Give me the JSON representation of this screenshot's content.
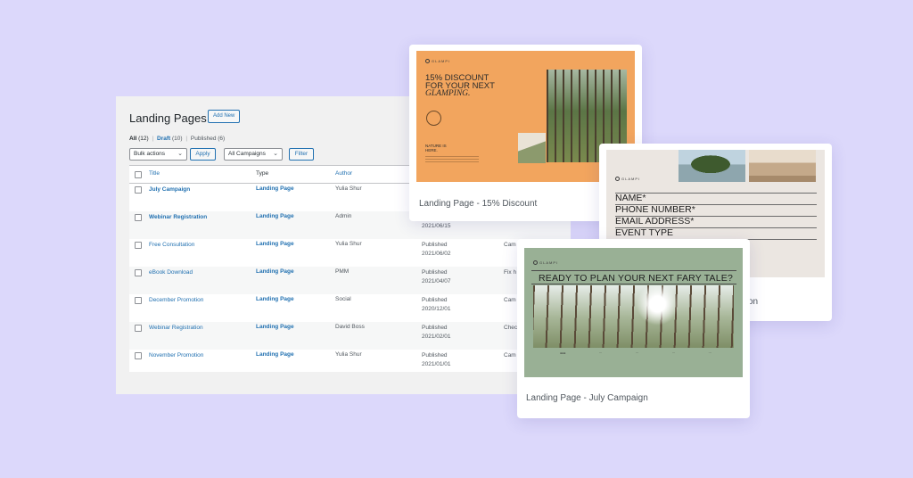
{
  "admin": {
    "page_title": "Landing Pages",
    "add_new_label": "Add New",
    "filters": {
      "all_label": "All",
      "all_count": "(12)",
      "separator": "|",
      "draft_label": "Draft",
      "draft_count": "(10)",
      "published_label": "Published",
      "published_count": "(6)"
    },
    "bulk_actions": "Bulk actions",
    "apply_label": "Apply",
    "campaigns_select": "All Campaigns",
    "filter_label": "Filter",
    "columns": {
      "title": "Title",
      "type": "Type",
      "author": "Author"
    },
    "rows": [
      {
        "title": "July Campaign",
        "type": "Landing Page",
        "author": "Yulia Shur",
        "status": "",
        "date": "",
        "campaign": "",
        "bold": true
      },
      {
        "title": "Webinar Registration",
        "type": "Landing Page",
        "author": "Admin",
        "status": "",
        "date": "2021/06/15",
        "campaign": "",
        "bold": true
      },
      {
        "title": "Free Consultation",
        "type": "Landing Page",
        "author": "Yulia Shur",
        "status": "Published",
        "date": "2021/06/02",
        "campaign": "Cam",
        "bold": false
      },
      {
        "title": "eBook Download",
        "type": "Landing Page",
        "author": "PMM",
        "status": "Published",
        "date": "2021/04/07",
        "campaign": "Fix h",
        "bold": false
      },
      {
        "title": "December Promotion",
        "type": "Landing Page",
        "author": "Social",
        "status": "Published",
        "date": "2020/12/01",
        "campaign": "Cam",
        "bold": false
      },
      {
        "title": "Webinar Registration",
        "type": "Landing Page",
        "author": "David Boss",
        "status": "Published",
        "date": "2021/02/01",
        "campaign": "Chec",
        "bold": false
      },
      {
        "title": "November Promotion",
        "type": "Landing Page",
        "author": "Yulia Shur",
        "status": "Published",
        "date": "2021/01/01",
        "campaign": "Cam",
        "bold": false
      }
    ]
  },
  "cards": {
    "discount": {
      "label": "Landing Page - 15% Discount",
      "brand": "GLAMPI",
      "headline_1": "15% DISCOUNT",
      "headline_2": "FOR YOUR NEXT",
      "headline_3": "GLAMPING.",
      "nature_1": "NATURE IS",
      "nature_2": "HERE."
    },
    "form": {
      "label_tail": "on",
      "brand": "GLAMPI",
      "fields": [
        "NAME*",
        "PHONE NUMBER*",
        "EMAIL ADDRESS*",
        "EVENT TYPE"
      ]
    },
    "july": {
      "label": "Landing Page - July Campaign",
      "brand": "GLAMPI",
      "headline": "READY TO PLAN YOUR NEXT FARY TALE?"
    }
  },
  "colors": {
    "background": "#dcd8fb",
    "accent": "#2271b1",
    "discount_bg": "#f2a55e",
    "july_bg": "#99b095"
  }
}
